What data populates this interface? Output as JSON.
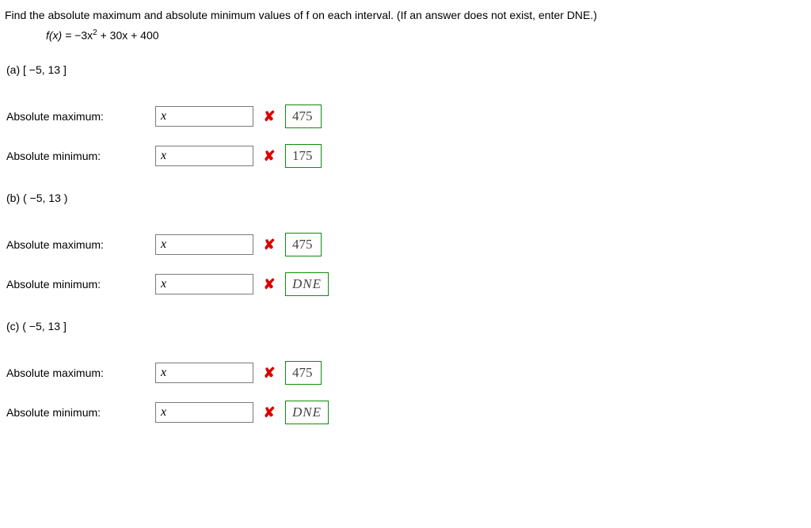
{
  "question": {
    "prompt": "Find the absolute maximum and absolute minimum values of f on each interval. (If an answer does not exist, enter DNE.)",
    "function_lhs": "f(x) = ",
    "function_rhs_a": "−3x",
    "function_rhs_exp": "2",
    "function_rhs_b": " + 30x + 400"
  },
  "labels": {
    "abs_max": "Absolute maximum:",
    "abs_min": "Absolute minimum:"
  },
  "input_placeholder": "x",
  "wrong_icon": "✘",
  "parts": {
    "a": {
      "label": "(a)  [ −5, 13 ]",
      "max_answer": "475",
      "min_answer": "175",
      "max_dne": false,
      "min_dne": false
    },
    "b": {
      "label": "(b)  ( −5, 13 )",
      "max_answer": "475",
      "min_answer": "DNE",
      "max_dne": false,
      "min_dne": true
    },
    "c": {
      "label": "(c)  ( −5, 13 ]",
      "max_answer": "475",
      "min_answer": "DNE",
      "max_dne": false,
      "min_dne": true
    }
  }
}
